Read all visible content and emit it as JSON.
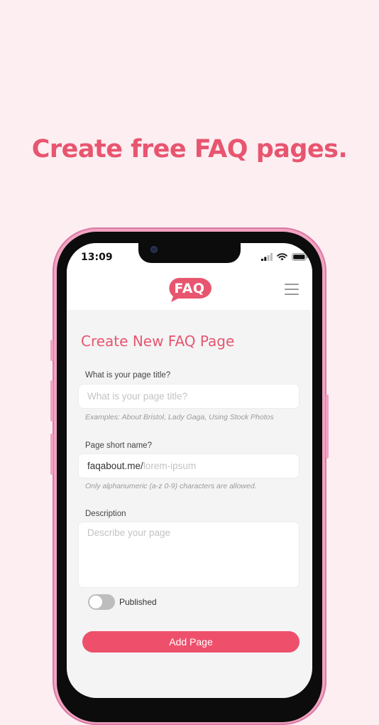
{
  "headline": "Create free FAQ pages.",
  "status_bar": {
    "time": "13:09"
  },
  "header": {
    "logo_text": "FAQ"
  },
  "form": {
    "title": "Create New FAQ Page",
    "page_title": {
      "label": "What is your page title?",
      "placeholder": "What is your page title?",
      "hint": "Examples: About Bristol,  Lady Gaga, Using Stock Photos"
    },
    "short_name": {
      "label": "Page short name?",
      "prefix": "faqabout.me/",
      "placeholder": "lorem-ipsum",
      "hint": "Only alphanumeric (a-z 0-9) characters are allowed."
    },
    "description": {
      "label": "Description",
      "placeholder": "Describe your page"
    },
    "published": {
      "label": "Published",
      "on": false
    },
    "submit_label": "Add Page"
  },
  "colors": {
    "accent": "#e8556f",
    "button": "#ee506c",
    "background": "#fdeef2"
  }
}
